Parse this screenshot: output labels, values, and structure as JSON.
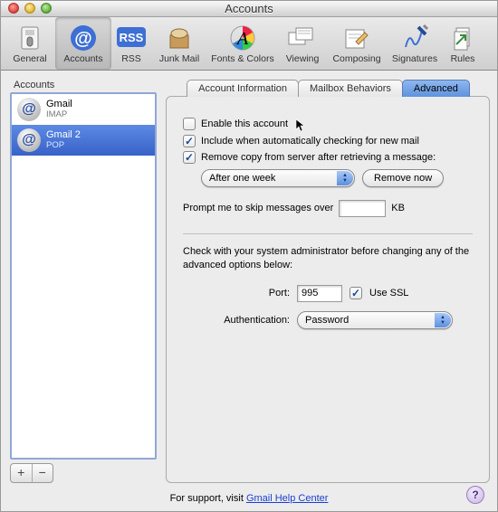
{
  "window": {
    "title": "Accounts"
  },
  "toolbar": {
    "items": [
      {
        "label": "General"
      },
      {
        "label": "Accounts"
      },
      {
        "label": "RSS"
      },
      {
        "label": "Junk Mail"
      },
      {
        "label": "Fonts & Colors"
      },
      {
        "label": "Viewing"
      },
      {
        "label": "Composing"
      },
      {
        "label": "Signatures"
      },
      {
        "label": "Rules"
      }
    ]
  },
  "sidebar": {
    "header": "Accounts",
    "accounts": [
      {
        "name": "Gmail",
        "protocol": "IMAP"
      },
      {
        "name": "Gmail 2",
        "protocol": "POP"
      }
    ]
  },
  "tabs": {
    "items": [
      {
        "label": "Account Information"
      },
      {
        "label": "Mailbox Behaviors"
      },
      {
        "label": "Advanced"
      }
    ]
  },
  "advanced": {
    "enable_label": "Enable this account",
    "enable_checked": false,
    "include_label": "Include when automatically checking for new mail",
    "include_checked": true,
    "remove_label": "Remove copy from server after retrieving a message:",
    "remove_checked": true,
    "remove_after_value": "After one week",
    "remove_now_label": "Remove now",
    "prompt_label_before": "Prompt me to skip messages over",
    "prompt_value": "",
    "prompt_label_after": "KB",
    "admin_note": "Check with your system administrator before changing any of the advanced options below:",
    "port_label": "Port:",
    "port_value": "995",
    "use_ssl_label": "Use SSL",
    "use_ssl_checked": true,
    "auth_label": "Authentication:",
    "auth_value": "Password"
  },
  "footer": {
    "prefix": "For support, visit ",
    "link_text": "Gmail Help Center"
  }
}
